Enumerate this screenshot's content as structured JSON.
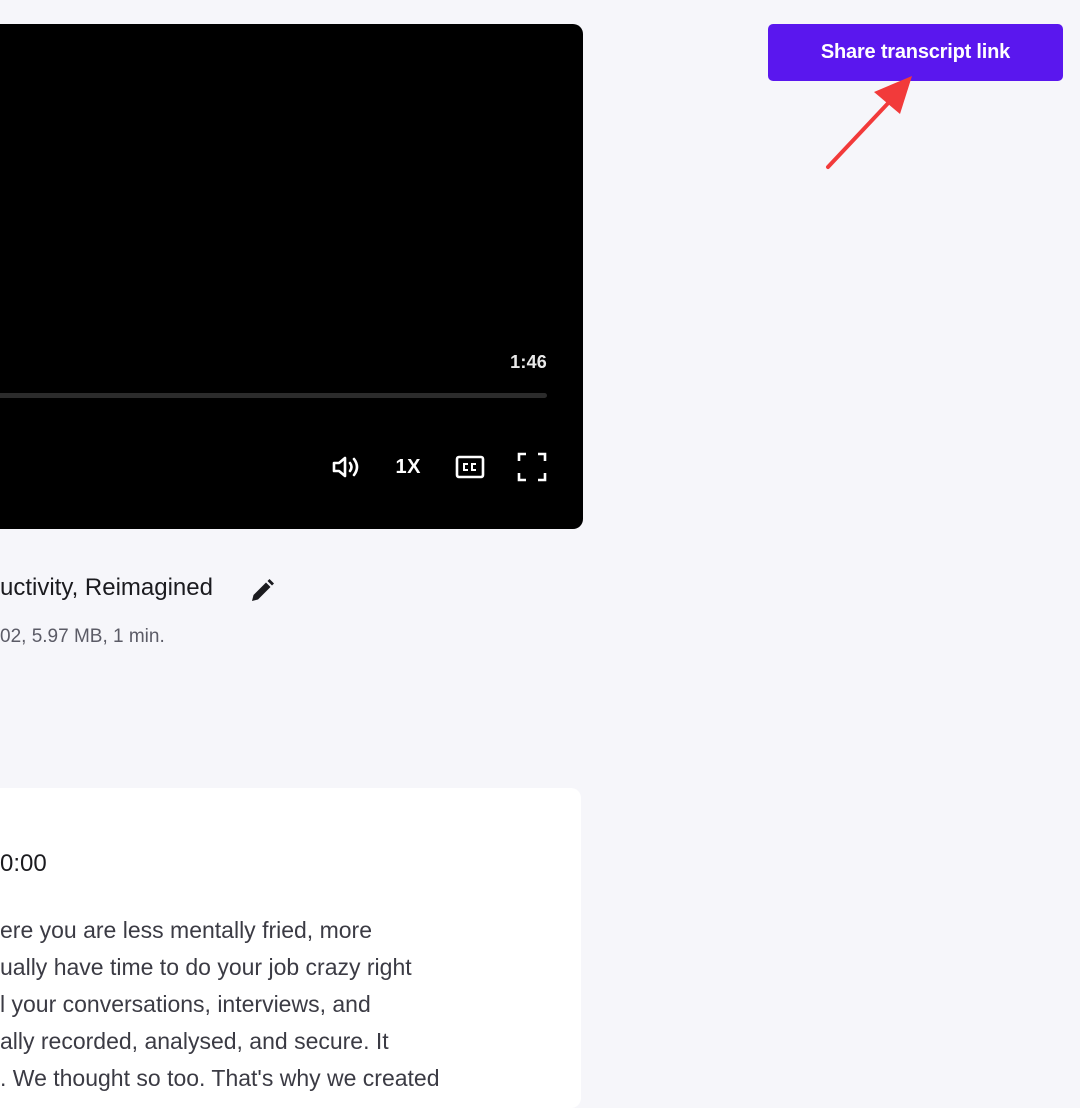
{
  "video": {
    "duration": "1:46",
    "progress": 0,
    "controls": {
      "volume_icon": "volume-icon",
      "speed_label": "1X",
      "captions_icon": "closed-captions-icon",
      "fullscreen_icon": "fullscreen-icon"
    }
  },
  "recording": {
    "title": "uctivity, Reimagined",
    "edit_icon": "pencil-icon",
    "meta": "02, 5.97 MB, 1 min."
  },
  "transcript": {
    "timestamp": "0:00",
    "lines": [
      "ere you are less mentally fried, more",
      "ually have time to do your job crazy right",
      "l your conversations, interviews, and",
      "ally recorded, analysed, and secure. It",
      ". We thought so too. That's why we created"
    ]
  },
  "header": {
    "share_label": "Share transcript link"
  },
  "colors": {
    "accent": "#5a17ee",
    "annotation_arrow": "#f23a3a",
    "background": "#f6f6fa",
    "player_background": "#000000"
  }
}
